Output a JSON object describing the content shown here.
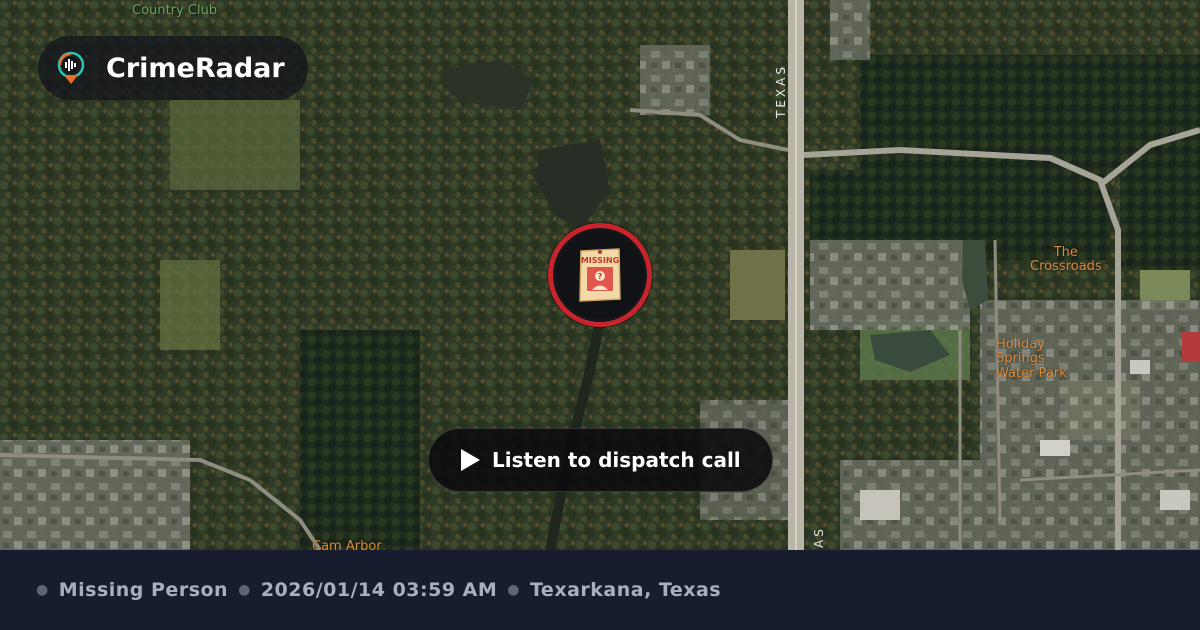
{
  "brand": {
    "name": "CrimeRadar",
    "logo_icon": "radar-pin-icon"
  },
  "map": {
    "labels": {
      "country_club": "Country Club",
      "crossroads": "The\nCrossroads",
      "holiday": "Holiday\nSprings\nWater Park",
      "texas_road": "TEXAS",
      "texas_road_bottom": "AS",
      "bottom_label": "Cam Arbor"
    },
    "marker": {
      "icon": "missing-poster-icon",
      "poster_text": "MISSING",
      "ring_color": "#c8242c"
    }
  },
  "audio": {
    "button_label": "Listen to dispatch call",
    "icon": "play-icon"
  },
  "footer": {
    "incident_type": "Missing Person",
    "datetime": "2026/01/14 03:59 AM",
    "location": "Texarkana, Texas"
  },
  "colors": {
    "footer_bg": "#171d2e",
    "footer_text": "#a9afbd",
    "accent_red": "#c8242c"
  }
}
